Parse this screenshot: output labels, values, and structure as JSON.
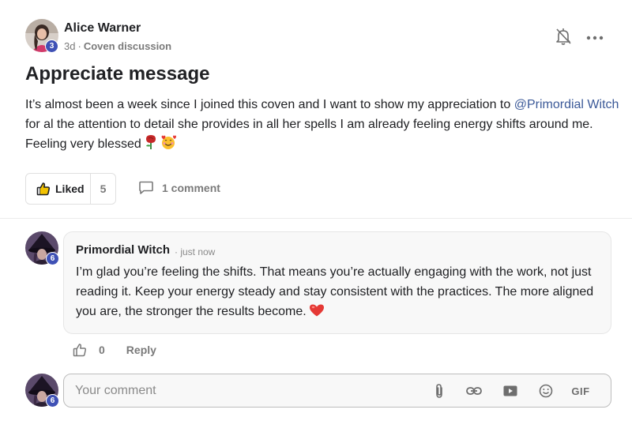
{
  "post": {
    "author": {
      "name": "Alice Warner",
      "level": "3"
    },
    "time": "3d",
    "separator": "·",
    "category": "Coven discussion",
    "title": "Appreciate message",
    "body": {
      "before_mention": "It’s almost been a week since I joined this coven and I want to show my appreciation to",
      "mention": "@Primordial Witch",
      "after_mention": "for al the attention to detail she provides in all her spells I am already feeling energy shifts around me. Feeling very blessed",
      "emojis": [
        "rose",
        "smiling-face-with-hearts"
      ]
    },
    "like_label": "Liked",
    "like_count": "5",
    "comments_label": "1 comment"
  },
  "comment": {
    "author": {
      "name": "Primordial Witch",
      "level": "6"
    },
    "time": "· just now",
    "text": "I’m glad you’re feeling the shifts. That means you’re actually engaging with the work, not just reading it. Keep your energy steady and stay consistent with the practices. The more aligned you are, the stronger the results become.",
    "emoji": "red-heart",
    "like_count": "0",
    "reply_label": "Reply"
  },
  "composer": {
    "avatar_level": "6",
    "placeholder": "Your comment",
    "tools": [
      "paperclip-icon",
      "link-icon",
      "video-icon",
      "emoji-icon",
      "gif"
    ],
    "gif_label": "GIF"
  },
  "colors": {
    "badge": "#3f51b5",
    "mention": "#3b5998",
    "muted": "#7a7a7a",
    "heart": "#e53935"
  }
}
